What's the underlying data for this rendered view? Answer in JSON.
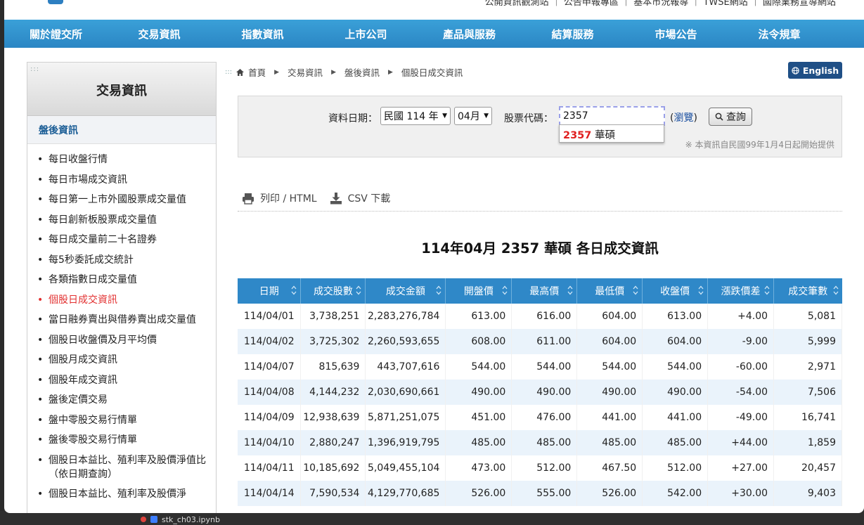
{
  "topbar": {
    "utility_text": "公開資訊觀測站 ｜ 公告申報專區 ｜ 基本市況報導 ｜ TWSE網站 ｜ 國際業務宣導網站"
  },
  "nav": {
    "items": [
      "關於證交所",
      "交易資訊",
      "指數資訊",
      "上市公司",
      "產品與服務",
      "結算服務",
      "市場公告",
      "法令規章"
    ]
  },
  "sidebar": {
    "title": "交易資訊",
    "section": "盤後資訊",
    "items": [
      "每日收盤行情",
      "每日市場成交資訊",
      "每日第一上市外國股票成交量值",
      "每日創新板股票成交量值",
      "每日成交量前二十名證券",
      "每5秒委託成交統計",
      "各類指數日成交量值",
      "個股日成交資訊",
      "當日融券賣出與借券賣出成交量值",
      "個股日收盤價及月平均價",
      "個股月成交資訊",
      "個股年成交資訊",
      "盤後定價交易",
      "盤中零股交易行情單",
      "盤後零股交易行情單",
      "個股日本益比、殖利率及股價淨值比（依日期查詢）",
      "個股日本益比、殖利率及股價淨"
    ],
    "active_index": 7
  },
  "breadcrumb": {
    "items": [
      "首頁",
      "交易資訊",
      "盤後資訊",
      "個股日成交資訊"
    ]
  },
  "english_button": "English",
  "filter": {
    "date_label": "資料日期：",
    "year_value": "民國 114 年",
    "month_value": "04月",
    "stock_label": "股票代碼：",
    "stock_value": "2357",
    "suggestion_code": "2357",
    "suggestion_name": "華碩",
    "browse_open": "(",
    "browse_link": "瀏覽",
    "browse_close": ")",
    "query_button": "查詢",
    "note": "※ 本資訊自民國99年1月4日起開始提供"
  },
  "tools": {
    "print": "列印 / HTML",
    "csv": "CSV 下載"
  },
  "report": {
    "title": "114年04月 2357 華碩 各日成交資訊",
    "columns": [
      "日期",
      "成交股數",
      "成交金額",
      "開盤價",
      "最高價",
      "最低價",
      "收盤價",
      "漲跌價差",
      "成交筆數"
    ],
    "rows": [
      [
        "114/04/01",
        "3,738,251",
        "2,283,276,784",
        "613.00",
        "616.00",
        "604.00",
        "613.00",
        "+4.00",
        "5,081"
      ],
      [
        "114/04/02",
        "3,725,302",
        "2,260,593,655",
        "608.00",
        "611.00",
        "604.00",
        "604.00",
        "-9.00",
        "5,999"
      ],
      [
        "114/04/07",
        "815,639",
        "443,707,616",
        "544.00",
        "544.00",
        "544.00",
        "544.00",
        "-60.00",
        "2,971"
      ],
      [
        "114/04/08",
        "4,144,232",
        "2,030,690,661",
        "490.00",
        "490.00",
        "490.00",
        "490.00",
        "-54.00",
        "7,506"
      ],
      [
        "114/04/09",
        "12,938,639",
        "5,871,251,075",
        "451.00",
        "476.00",
        "441.00",
        "441.00",
        "-49.00",
        "16,741"
      ],
      [
        "114/04/10",
        "2,880,247",
        "1,396,919,795",
        "485.00",
        "485.00",
        "485.00",
        "485.00",
        "+44.00",
        "1,859"
      ],
      [
        "114/04/11",
        "10,185,692",
        "5,049,455,104",
        "473.00",
        "512.00",
        "467.50",
        "512.00",
        "+27.00",
        "20,457"
      ],
      [
        "114/04/14",
        "7,590,534",
        "4,129,770,685",
        "526.00",
        "555.00",
        "526.00",
        "542.00",
        "+30.00",
        "9,403"
      ]
    ]
  },
  "taskbar": {
    "file_name": "stk_ch03.ipynb"
  }
}
